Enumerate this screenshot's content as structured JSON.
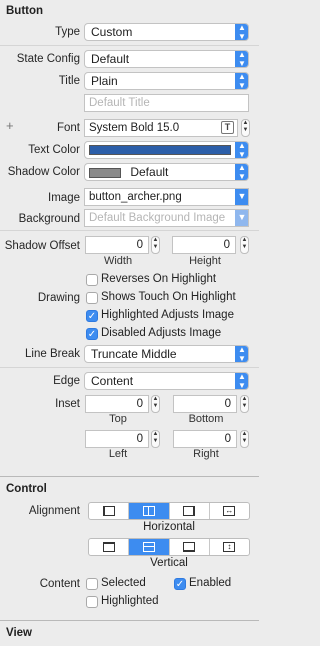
{
  "button_section": {
    "title": "Button",
    "type": {
      "label": "Type",
      "value": "Custom"
    },
    "state_config": {
      "label": "State Config",
      "value": "Default"
    },
    "title_row": {
      "label": "Title",
      "value": "Plain",
      "placeholder": "Default Title"
    },
    "font": {
      "label": "Font",
      "value": "System Bold 15.0"
    },
    "text_color": {
      "label": "Text Color",
      "swatch": "#2c5ea8"
    },
    "shadow_color": {
      "label": "Shadow Color",
      "value": "Default",
      "swatch": "#8a8a8a"
    },
    "image": {
      "label": "Image",
      "value": "button_archer.png"
    },
    "background": {
      "label": "Background",
      "placeholder": "Default Background Image"
    },
    "shadow_offset": {
      "label": "Shadow Offset",
      "width": "0",
      "height": "0",
      "width_label": "Width",
      "height_label": "Height"
    },
    "drawing": {
      "label": "Drawing",
      "options": [
        {
          "label": "Reverses On Highlight",
          "checked": false
        },
        {
          "label": "Shows Touch On Highlight",
          "checked": false
        },
        {
          "label": "Highlighted Adjusts Image",
          "checked": true
        },
        {
          "label": "Disabled Adjusts Image",
          "checked": true
        }
      ]
    },
    "line_break": {
      "label": "Line Break",
      "value": "Truncate Middle"
    },
    "edge": {
      "label": "Edge",
      "value": "Content"
    },
    "inset": {
      "label": "Inset",
      "top": "0",
      "bottom": "0",
      "left": "0",
      "right": "0",
      "top_label": "Top",
      "bottom_label": "Bottom",
      "left_label": "Left",
      "right_label": "Right"
    }
  },
  "control_section": {
    "title": "Control",
    "alignment": {
      "label": "Alignment",
      "horizontal_label": "Horizontal",
      "vertical_label": "Vertical"
    },
    "content": {
      "label": "Content",
      "options": [
        {
          "label": "Selected",
          "checked": false
        },
        {
          "label": "Enabled",
          "checked": true
        },
        {
          "label": "Highlighted",
          "checked": false
        }
      ]
    }
  },
  "view_section": {
    "title": "View"
  },
  "colors": {
    "accent": "#3d8cf0"
  }
}
